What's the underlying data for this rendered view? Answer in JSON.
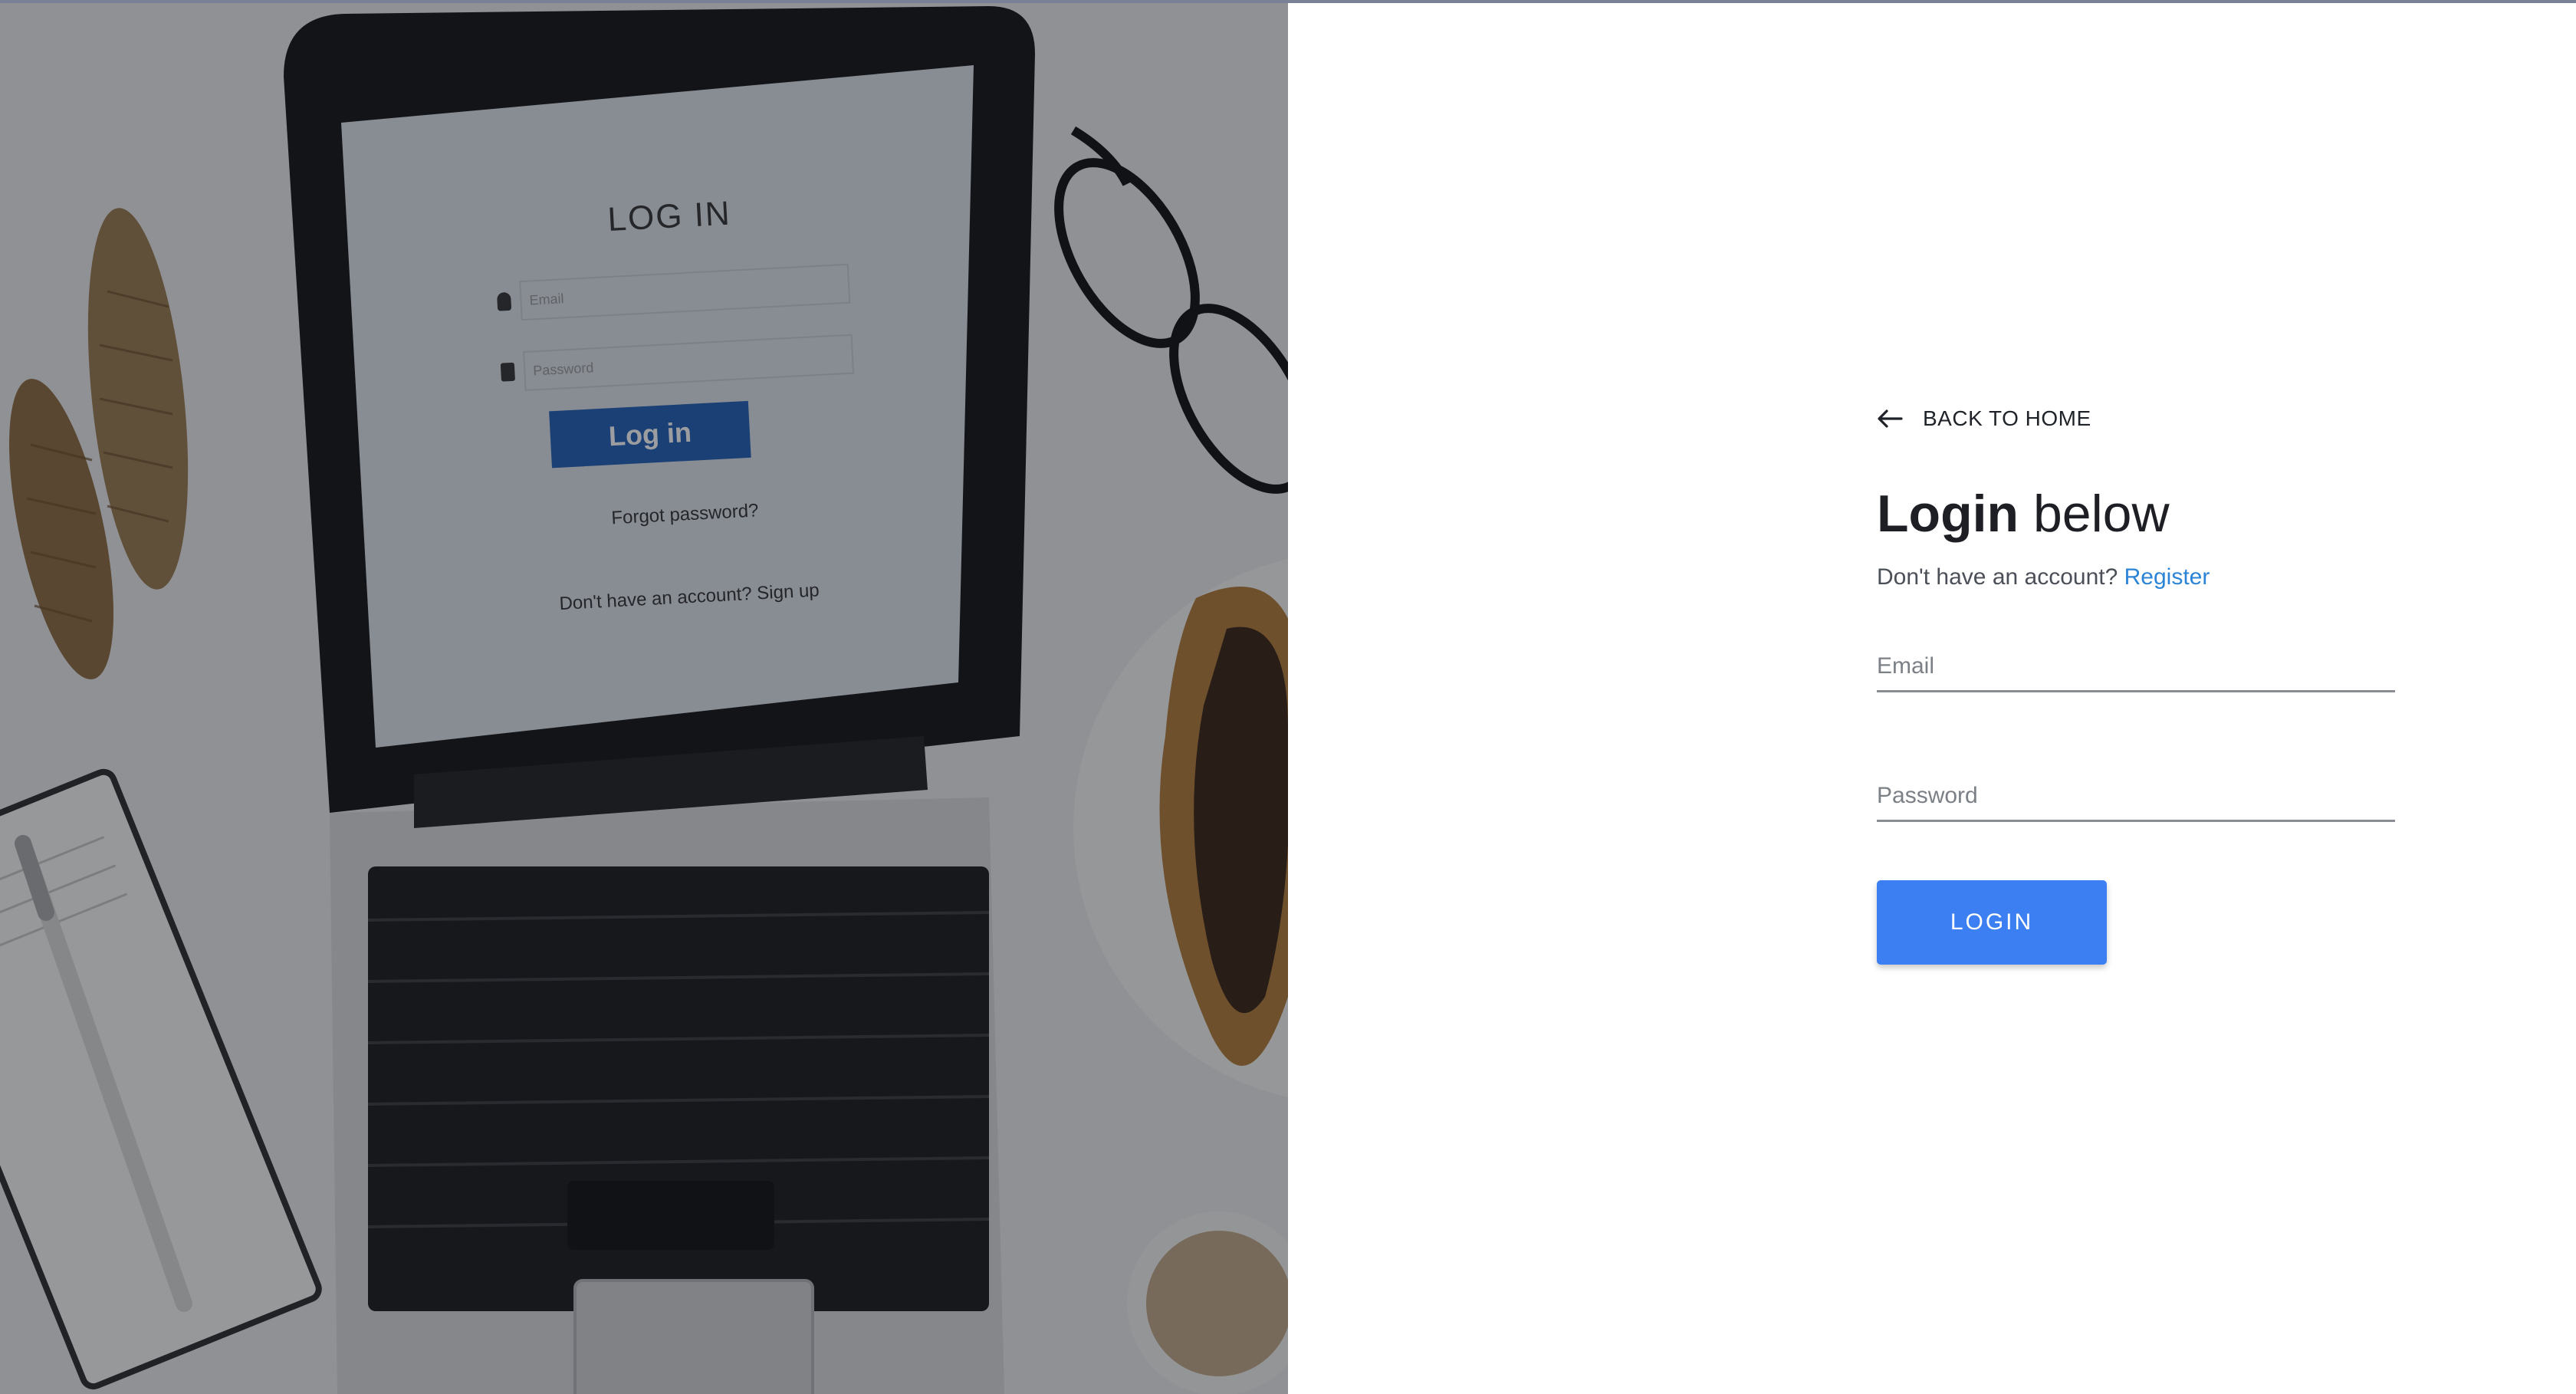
{
  "hero": {
    "image_label": "laptop-desk-photo",
    "screen_title": "LOG IN",
    "screen_email_placeholder": "Email",
    "screen_password_placeholder": "Password",
    "screen_button": "Log in",
    "screen_forgot": "Forgot password?",
    "screen_signup": "Don't have an account? Sign up"
  },
  "back": {
    "label": "BACK TO HOME",
    "icon": "arrow-left-icon"
  },
  "heading": {
    "strong": "Login",
    "light": " below"
  },
  "subtitle": {
    "text": "Don't have an account? ",
    "link": "Register"
  },
  "email": {
    "placeholder": "Email",
    "value": ""
  },
  "password": {
    "placeholder": "Password",
    "value": ""
  },
  "login": {
    "label": "LOGIN"
  },
  "colors": {
    "accent": "#3b7ff2",
    "link": "#2b84d6",
    "text": "#1d1f24"
  }
}
